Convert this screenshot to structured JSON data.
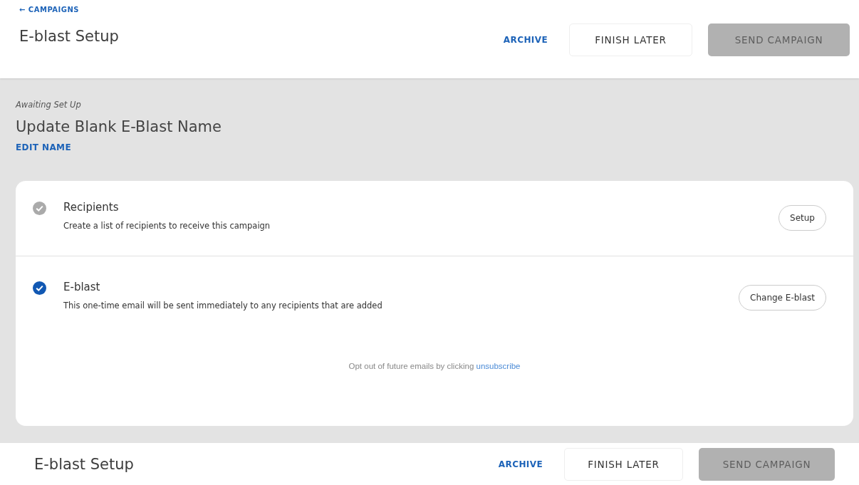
{
  "header": {
    "back_link": "← CAMPAIGNS",
    "title": "E-blast Setup",
    "archive": "ARCHIVE",
    "finish_later": "FINISH LATER",
    "send": {
      "label": "SEND CAMPAIGN",
      "disabled": true
    }
  },
  "campaign": {
    "status": "Awaiting Set Up",
    "name": "Update Blank E-Blast Name",
    "edit": "EDIT NAME"
  },
  "steps": [
    {
      "title": "Recipients",
      "description": "Create a list of recipients to receive this campaign",
      "action": "Setup",
      "completed": false
    },
    {
      "title": "E-blast",
      "description": "This one-time email will be sent immediately to any recipients that are added",
      "action": "Change E-blast",
      "completed": true
    }
  ],
  "footer_note": {
    "text": "Opt out of future emails by clicking",
    "link": "unsubscribe"
  },
  "repeated_header": {
    "title": "E-blast Setup",
    "archive": "ARCHIVE",
    "finish_later": "FINISH LATER",
    "send": {
      "label": "SEND CAMPAIGN",
      "disabled": true
    }
  }
}
